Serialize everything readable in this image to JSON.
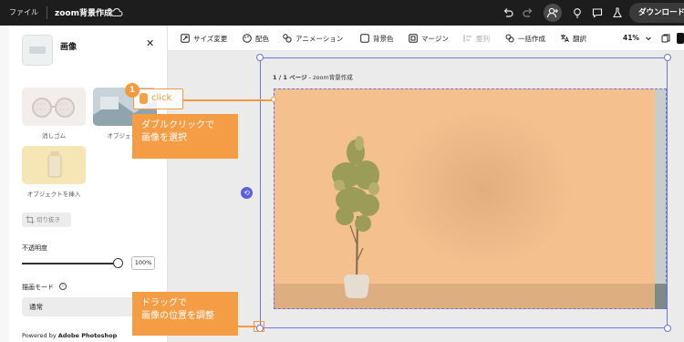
{
  "topbar": {
    "menu_label": "ファイル",
    "document_title": "zoom背景作成",
    "download_label": "ダウンロード"
  },
  "panel": {
    "title": "画像",
    "tiles": [
      {
        "label": "消しゴム"
      },
      {
        "label": "オブジェクト"
      },
      {
        "label": "オブジェクトを挿入"
      }
    ],
    "crop_label": "切り抜き",
    "opacity_label": "不透明度",
    "opacity_value": "100%",
    "blend_mode_label": "描画モード",
    "blend_mode_value": "通常",
    "powered_prefix": "Powered by ",
    "powered_brand": "Adobe Photoshop"
  },
  "toolbar": {
    "resize": "サイズ変更",
    "color": "配色",
    "animation": "アニメーション",
    "bg_color": "背景色",
    "margin": "マージン",
    "align": "整列",
    "batch": "一括作成",
    "translate": "翻訳",
    "zoom": "41%"
  },
  "canvas": {
    "page_indicator": "1 / 1 ページ",
    "page_name": " - zoom背景作成"
  },
  "annotations": {
    "step_number": "1",
    "click_label": "click",
    "callout1_line1": "ダブルクリックで",
    "callout1_line2": "画像を選択",
    "callout2_line1": "ドラッグで",
    "callout2_line2": "画像の位置を調整"
  },
  "colors": {
    "accent": "#6f73e0",
    "annotation": "#f59d45",
    "image_background": "#f4c08e"
  }
}
